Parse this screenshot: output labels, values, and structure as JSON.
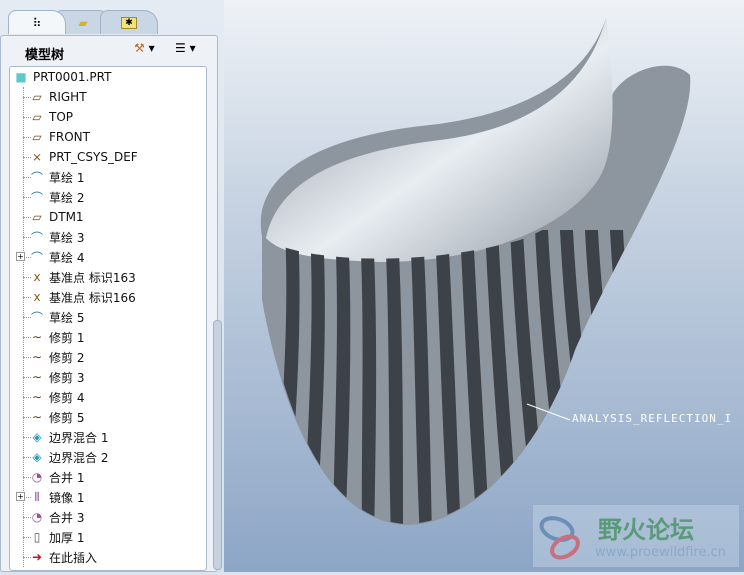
{
  "panel": {
    "title": "模型树",
    "tabs": [
      "model-tree",
      "folders",
      "favorites"
    ]
  },
  "tree": [
    {
      "label": "PRT0001.PRT",
      "icon": "part"
    },
    {
      "label": "RIGHT",
      "icon": "datum-plane"
    },
    {
      "label": "TOP",
      "icon": "datum-plane"
    },
    {
      "label": "FRONT",
      "icon": "datum-plane"
    },
    {
      "label": "PRT_CSYS_DEF",
      "icon": "csys"
    },
    {
      "label": "草绘 1",
      "icon": "sketch"
    },
    {
      "label": "草绘 2",
      "icon": "sketch"
    },
    {
      "label": "DTM1",
      "icon": "datum-plane"
    },
    {
      "label": "草绘 3",
      "icon": "sketch"
    },
    {
      "label": "草绘 4",
      "icon": "sketch",
      "expandable": true
    },
    {
      "label": "基准点 标识163",
      "icon": "datum-point"
    },
    {
      "label": "基准点 标识166",
      "icon": "datum-point"
    },
    {
      "label": "草绘 5",
      "icon": "sketch"
    },
    {
      "label": "修剪 1",
      "icon": "trim"
    },
    {
      "label": "修剪 2",
      "icon": "trim"
    },
    {
      "label": "修剪 3",
      "icon": "trim"
    },
    {
      "label": "修剪 4",
      "icon": "trim"
    },
    {
      "label": "修剪 5",
      "icon": "trim"
    },
    {
      "label": "边界混合 1",
      "icon": "boundary-blend"
    },
    {
      "label": "边界混合 2",
      "icon": "boundary-blend"
    },
    {
      "label": "合并 1",
      "icon": "merge"
    },
    {
      "label": "镜像 1",
      "icon": "mirror",
      "expandable": true
    },
    {
      "label": "合并 3",
      "icon": "merge"
    },
    {
      "label": "加厚 1",
      "icon": "thicken"
    },
    {
      "label": "在此插入",
      "icon": "insert-arrow"
    }
  ],
  "viewport": {
    "annotation": "ANALYSIS_REFLECTION_I"
  },
  "watermark": {
    "title": "野火论坛",
    "url": "www.proewildfire.cn"
  }
}
